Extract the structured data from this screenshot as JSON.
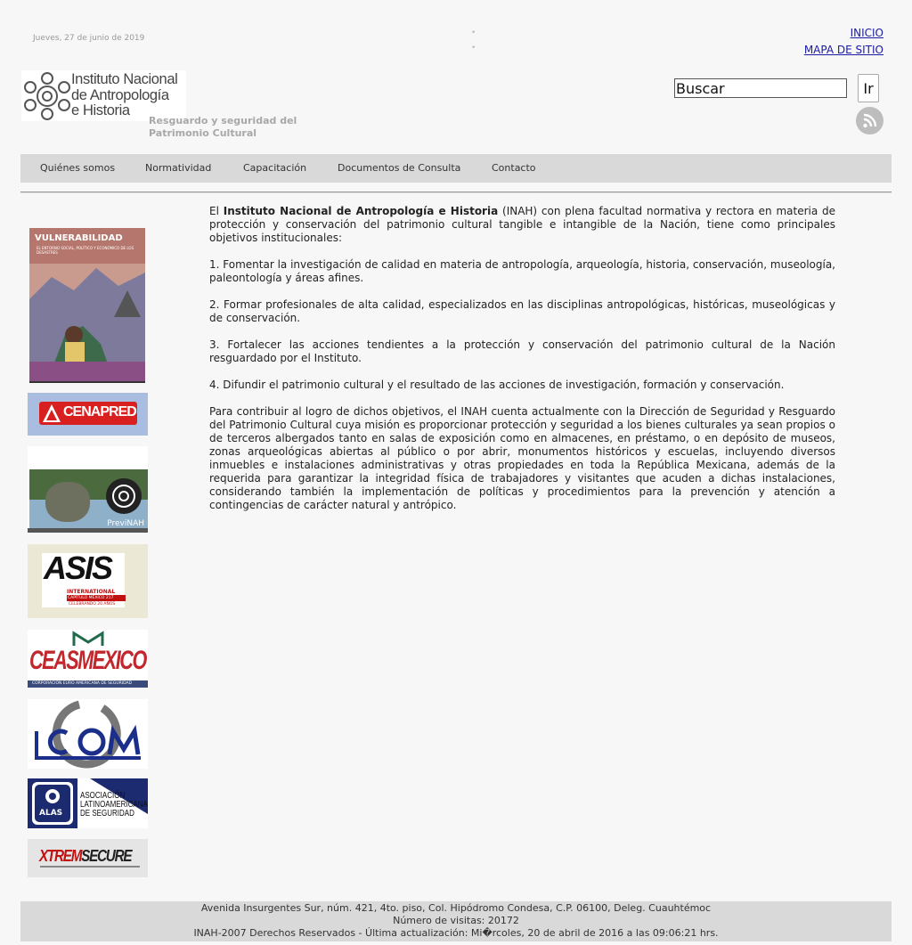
{
  "header": {
    "date": "Jueves, 27 de junio de 2019",
    "links": [
      "INICIO",
      "MAPA DE SITIO"
    ],
    "logo_lines": [
      "Instituto Nacional",
      "de Antropología",
      "e Historia"
    ],
    "subtitle_lines": [
      "Resguardo y seguridad del",
      "Patrimonio Cultural"
    ],
    "search": {
      "value": "Buscar",
      "button": "Ir"
    },
    "rss_icon": "rss-icon"
  },
  "nav": [
    "Quiénes somos",
    "Normatividad",
    "Capacitación",
    "Documentos de Consulta",
    "Contacto"
  ],
  "sidebar": {
    "book": {
      "title": "VULNERABILIDAD",
      "subtitle": "EL ENTORNO SOCIAL, POLÍTICO Y ECONÓMICO DE LOS DESASTRES"
    },
    "cenapred": "CENAPRED",
    "previnah": "PreviNAH",
    "asis": {
      "name": "ASIS",
      "line1": "INTERNATIONAL",
      "line2": "CAPÍTULO MÉXICO 217",
      "line3": "CELEBRANDO 20 AÑOS"
    },
    "ceas": {
      "name": "CEASMEXICO",
      "tag": "CORPORACIÓN EURO AMERICANA DE SEGURIDAD"
    },
    "icom": "ICOM",
    "alas": {
      "name": "ALAS",
      "text": [
        "ASOCIACIÓN",
        "LATINOAMERICANA",
        "DE SEGURIDAD"
      ]
    },
    "xrem": "XTREMSECURE"
  },
  "content": {
    "intro_pre": "El ",
    "intro_bold": "Instituto Nacional de Antropología e Historia",
    "intro_post": " (INAH) con plena facultad normativa y rectora en materia de protección y conservación del patrimonio cultural tangible e intangible de la Nación, tiene como principales objetivos institucionales:",
    "items": [
      "1. Fomentar la investigación de calidad en materia de antropología, arqueología, historia, conservación, museología, paleontología y áreas afines.",
      "2. Formar profesionales de alta calidad, especializados en las disciplinas antropológicas, históricas, museológicas y de conservación.",
      "3. Fortalecer las acciones tendientes a la protección y conservación del patrimonio cultural de la Nación resguardado por el Instituto.",
      "4. Difundir el patrimonio cultural y el resultado de las acciones de investigación, formación y conservación."
    ],
    "closing": "Para contribuir al logro de dichos objetivos, el INAH cuenta actualmente con la Dirección de Seguridad y Resguardo del Patrimonio Cultural cuya misión es proporcionar protección y seguridad a los bienes culturales ya sean propios o de terceros albergados tanto en salas de exposición como en almacenes, en préstamo, o en depósito de museos, zonas arqueológicas abiertas al público o por abrir, monumentos históricos y escuelas, incluyendo diversos inmuebles e instalaciones administrativas y otras propiedades en toda la República Mexicana, además de la requerida para garantizar la integridad física de trabajadores y visitantes que acuden a dichas instalaciones, considerando también la implementación de políticas y procedimientos para la prevención y atención a contingencias de carácter natural y antrópico."
  },
  "footer": {
    "address": "Avenida Insurgentes Sur, núm. 421, 4to. piso, Col. Hipódromo Condesa, C.P. 06100, Deleg. Cuauhtémoc",
    "visits": "Número de visitas: 20172",
    "rights": "INAH-2007 Derechos Reservados -  Última actualización: Mi�rcoles, 20 de abril de 2016 a las 09:06:21 hrs."
  }
}
